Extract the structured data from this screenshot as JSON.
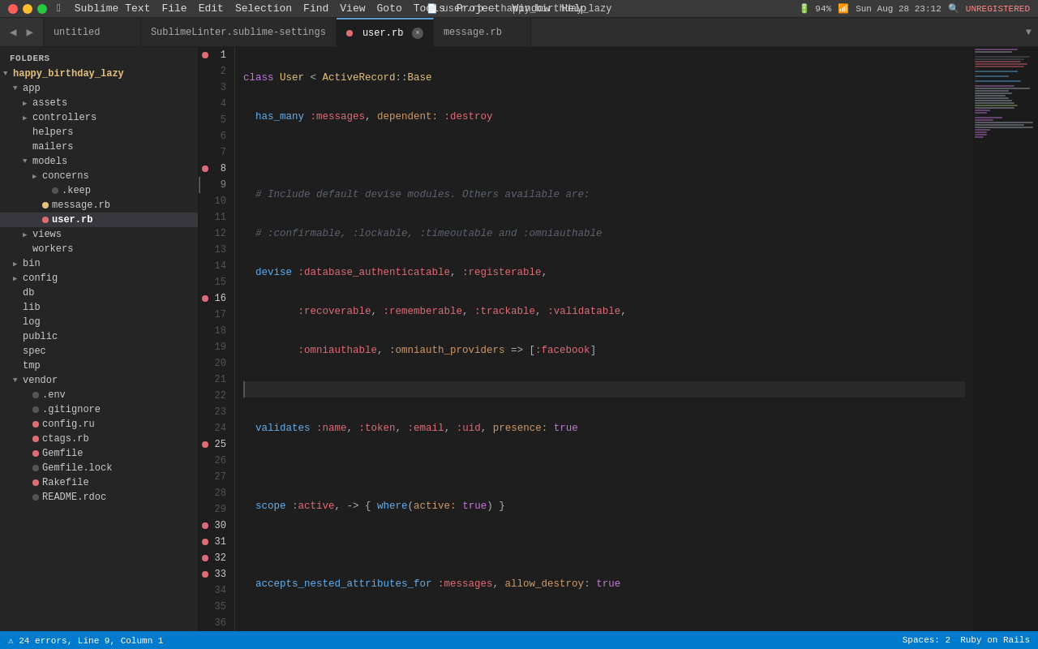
{
  "titlebar": {
    "title": "user.rb — happy_birthday_lazy",
    "menus": [
      "",
      "Sublime Text",
      "File",
      "Edit",
      "Selection",
      "Find",
      "View",
      "Goto",
      "Tools",
      "Project",
      "Window",
      "Help"
    ],
    "right_items": [
      "94%",
      "Sun Aug 28  23:12",
      "UNREGISTERED"
    ]
  },
  "tabs": [
    {
      "id": "untitled",
      "label": "untitled",
      "active": false,
      "dot_color": null
    },
    {
      "id": "sublimelinter",
      "label": "SublimeLinter.sublime-settings",
      "active": false,
      "dot_color": null
    },
    {
      "id": "user.rb",
      "label": "user.rb",
      "active": true,
      "dot_color": "red",
      "closeable": true
    },
    {
      "id": "message.rb",
      "label": "message.rb",
      "active": false,
      "dot_color": null
    }
  ],
  "sidebar": {
    "header": "FOLDERS",
    "items": [
      {
        "id": "happy_birthday_lazy",
        "label": "happy_birthday_lazy",
        "depth": 0,
        "type": "folder",
        "open": true,
        "dot": null
      },
      {
        "id": "app",
        "label": "app",
        "depth": 1,
        "type": "folder",
        "open": true,
        "dot": null
      },
      {
        "id": "assets",
        "label": "assets",
        "depth": 2,
        "type": "folder",
        "open": false,
        "dot": null
      },
      {
        "id": "controllers",
        "label": "controllers",
        "depth": 2,
        "type": "folder",
        "open": false,
        "dot": null
      },
      {
        "id": "helpers",
        "label": "helpers",
        "depth": 2,
        "type": "folder",
        "open": false,
        "dot": null
      },
      {
        "id": "mailers",
        "label": "mailers",
        "depth": 2,
        "type": "folder",
        "open": false,
        "dot": null
      },
      {
        "id": "models",
        "label": "models",
        "depth": 2,
        "type": "folder",
        "open": true,
        "dot": null
      },
      {
        "id": "concerns",
        "label": "concerns",
        "depth": 3,
        "type": "folder",
        "open": false,
        "dot": null
      },
      {
        "id": ".keep",
        "label": ".keep",
        "depth": 4,
        "type": "file",
        "dot": "grey"
      },
      {
        "id": "message.rb",
        "label": "message.rb",
        "depth": 3,
        "type": "file",
        "dot": "orange"
      },
      {
        "id": "user.rb",
        "label": "user.rb",
        "depth": 3,
        "type": "file",
        "dot": "red",
        "selected": true
      },
      {
        "id": "views",
        "label": "views",
        "depth": 2,
        "type": "folder",
        "open": false,
        "dot": null
      },
      {
        "id": "workers",
        "label": "workers",
        "depth": 2,
        "type": "folder",
        "open": false,
        "dot": null
      },
      {
        "id": "bin",
        "label": "bin",
        "depth": 1,
        "type": "folder",
        "open": false,
        "dot": null
      },
      {
        "id": "config",
        "label": "config",
        "depth": 1,
        "type": "folder",
        "open": false,
        "dot": null
      },
      {
        "id": "db",
        "label": "db",
        "depth": 1,
        "type": "folder",
        "open": false,
        "dot": null
      },
      {
        "id": "lib",
        "label": "lib",
        "depth": 1,
        "type": "folder",
        "open": false,
        "dot": null
      },
      {
        "id": "log",
        "label": "log",
        "depth": 1,
        "type": "folder",
        "open": false,
        "dot": null
      },
      {
        "id": "public",
        "label": "public",
        "depth": 1,
        "type": "folder",
        "open": false,
        "dot": null
      },
      {
        "id": "spec",
        "label": "spec",
        "depth": 1,
        "type": "folder",
        "open": false,
        "dot": null
      },
      {
        "id": "tmp",
        "label": "tmp",
        "depth": 1,
        "type": "folder",
        "open": false,
        "dot": null
      },
      {
        "id": "vendor",
        "label": "vendor",
        "depth": 1,
        "type": "folder",
        "open": true,
        "dot": null
      },
      {
        "id": ".env",
        "label": ".env",
        "depth": 2,
        "type": "file",
        "dot": "grey"
      },
      {
        "id": ".gitignore",
        "label": ".gitignore",
        "depth": 2,
        "type": "file",
        "dot": "grey"
      },
      {
        "id": "config.ru",
        "label": "config.ru",
        "depth": 2,
        "type": "file",
        "dot": "red"
      },
      {
        "id": "ctags.rb",
        "label": "ctags.rb",
        "depth": 2,
        "type": "file",
        "dot": "red"
      },
      {
        "id": "Gemfile",
        "label": "Gemfile",
        "depth": 2,
        "type": "file",
        "dot": "red"
      },
      {
        "id": "Gemfile.lock",
        "label": "Gemfile.lock",
        "depth": 2,
        "type": "file",
        "dot": "grey"
      },
      {
        "id": "Rakefile",
        "label": "Rakefile",
        "depth": 2,
        "type": "file",
        "dot": "red"
      },
      {
        "id": "README.rdoc",
        "label": "README.rdoc",
        "depth": 2,
        "type": "file",
        "dot": "grey"
      }
    ]
  },
  "editor": {
    "filename": "user.rb",
    "breakpoint_lines": [
      1,
      8,
      16,
      25,
      31,
      32,
      33
    ],
    "current_line": 9
  },
  "statusbar": {
    "left": "⚠ 24 errors, Line 9, Column 1",
    "right_spaces": "Spaces: 2",
    "right_lang": "Ruby on Rails"
  }
}
